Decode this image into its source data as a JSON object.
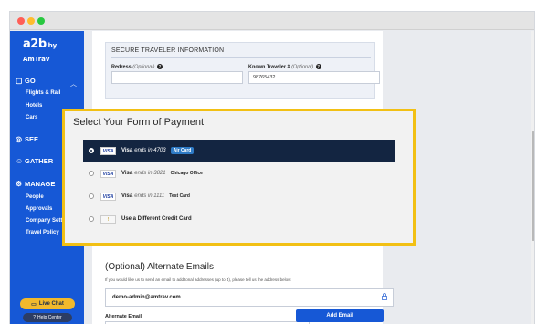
{
  "window": {
    "dots": [
      "#ff5f57",
      "#febc2e",
      "#28c840"
    ]
  },
  "sidebar": {
    "logo": "a2b",
    "logo_sub": "by AmTrav",
    "sections": [
      {
        "label": "GO",
        "icon": "briefcase-icon",
        "expanded": true
      },
      {
        "label": "SEE",
        "icon": "eye-icon"
      },
      {
        "label": "GATHER",
        "icon": "people-icon"
      },
      {
        "label": "MANAGE",
        "icon": "gear-icon"
      }
    ],
    "go_items": [
      "Flights & Rail",
      "Hotels",
      "Cars"
    ],
    "manage_items": [
      "People",
      "Approvals",
      "Company Setti",
      "Travel Policy"
    ],
    "live_chat": "Live Chat",
    "help_center": "Help Center"
  },
  "secure": {
    "title": "SECURE TRAVELER INFORMATION",
    "redress_label": "Redress",
    "redress_optional": "(Optional)",
    "redress_value": "",
    "ktn_label": "Known Traveler #",
    "ktn_optional": "(Optional)",
    "ktn_value": "98765432"
  },
  "payment": {
    "title": "Select Your Form of Payment",
    "options": [
      {
        "brand": "Visa",
        "ends": "ends in 4703",
        "tag": "Air Card",
        "selected": true
      },
      {
        "brand": "Visa",
        "ends": "ends in 3821",
        "tag": "Chicago Office"
      },
      {
        "brand": "Visa",
        "ends": "ends in 1111",
        "tag": "Test Card"
      },
      {
        "text": "Use a Different Credit Card"
      }
    ]
  },
  "alternate": {
    "title": "(Optional) Alternate Emails",
    "description": "If you would like us to send an email to additonal addresses (up to 4), please tell us the address below.",
    "existing_email": "demo-admin@amtrav.com",
    "label": "Alternate Email",
    "add_button": "Add Email"
  },
  "colors": {
    "primary": "#1658d6",
    "highlight": "#f2c014",
    "selected_row": "#132541",
    "chat": "#f2b92c"
  }
}
